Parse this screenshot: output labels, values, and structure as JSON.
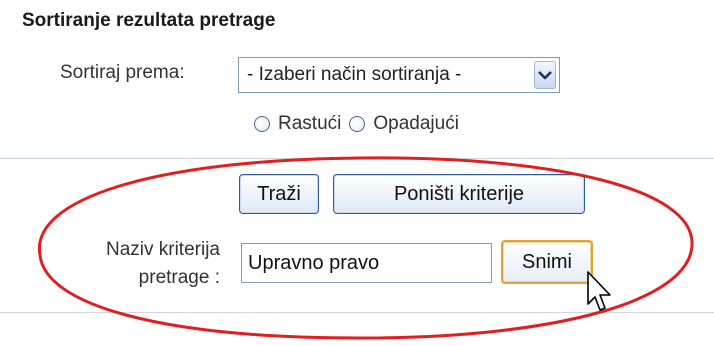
{
  "section": {
    "title": "Sortiranje rezultata pretrage"
  },
  "sort": {
    "label": "Sortiraj prema:",
    "select_value": "- Izaberi način sortiranja -",
    "radio_asc": "Rastući",
    "radio_desc": "Opadajući"
  },
  "actions": {
    "search_label": "Traži",
    "reset_label": "Poništi kriterije"
  },
  "save_criteria": {
    "label_line1": "Naziv kriterija",
    "label_line2": "pretrage :",
    "input_value": "Upravno pravo",
    "save_label": "Snimi"
  },
  "colors": {
    "highlight_ellipse": "#e02020",
    "button_border": "#2e5b9a",
    "save_button_border": "#e0a23a"
  },
  "icons": {
    "select_arrow": "chevron-down-icon",
    "cursor": "mouse-pointer-icon"
  }
}
